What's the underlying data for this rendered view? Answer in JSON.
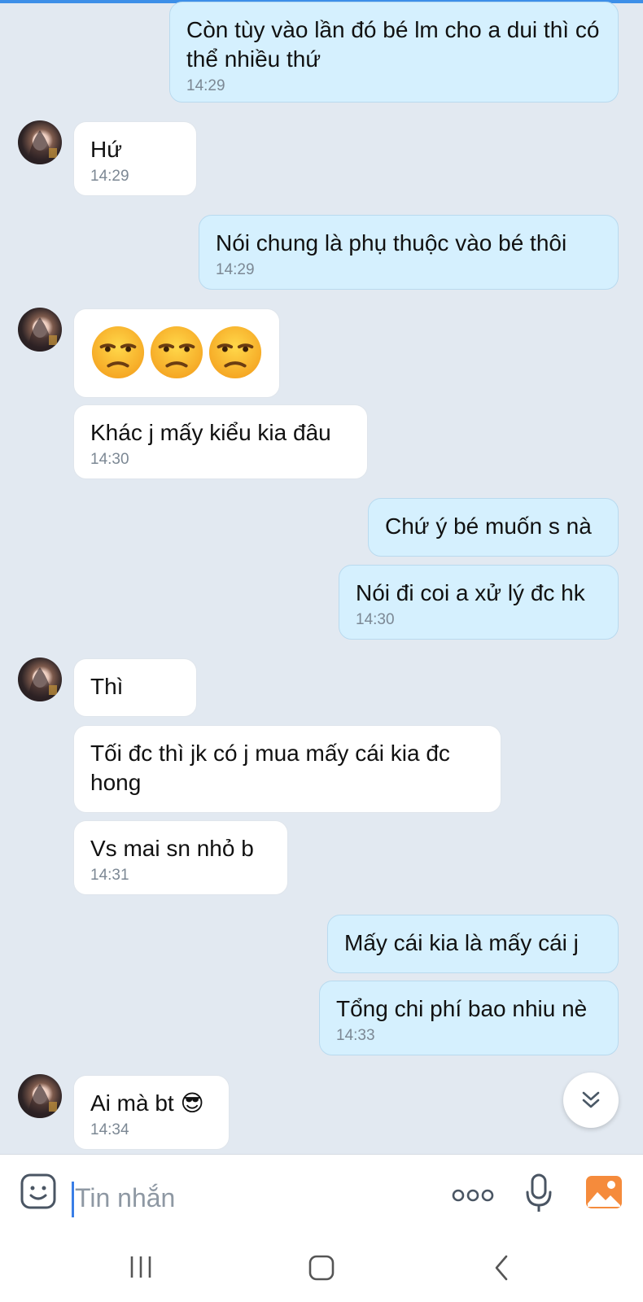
{
  "messages": [
    {
      "dir": "out",
      "text": "Còn tùy vào lần đó bé lm cho a dui thì có thể nhiều thứ",
      "time": "14:29"
    },
    {
      "dir": "in",
      "text": "Hứ",
      "time": "14:29"
    },
    {
      "dir": "out",
      "text": "Nói chung là phụ thuộc vào bé thôi",
      "time": "14:29"
    },
    {
      "dir": "in",
      "emoji": "😒😒😒"
    },
    {
      "dir": "in",
      "text": "Khác j mấy kiểu kia đâu",
      "time": "14:30"
    },
    {
      "dir": "out",
      "text": "Chứ ý bé muốn s nà"
    },
    {
      "dir": "out",
      "text": "Nói đi coi a xử lý đc hk",
      "time": "14:30"
    },
    {
      "dir": "in",
      "text": "Thì"
    },
    {
      "dir": "in",
      "text": "Tối đc thì jk có j mua mấy cái kia đc hong"
    },
    {
      "dir": "in",
      "text": "Vs mai sn nhỏ b",
      "time": "14:31"
    },
    {
      "dir": "out",
      "text": "Mấy cái kia là mấy cái j"
    },
    {
      "dir": "out",
      "text": "Tổng chi phí bao nhiu nè",
      "time": "14:33"
    },
    {
      "dir": "in",
      "text": "Ai mà bt 😎",
      "time": "14:34"
    }
  ],
  "composer": {
    "placeholder": "Tin nhắn",
    "icons": [
      "sticker-icon",
      "more-icon",
      "microphone-icon",
      "photo-icon"
    ]
  },
  "scroll_button": {
    "icon": "double-chevron-down-icon"
  },
  "nav": {
    "icons": [
      "recent-apps-icon",
      "home-icon",
      "back-icon"
    ]
  },
  "colors": {
    "outgoing": "#d5f0fe",
    "incoming": "#ffffff",
    "background": "#e2e9f1",
    "accent": "#3a7ee6",
    "photo_icon": "#f58b3c"
  }
}
